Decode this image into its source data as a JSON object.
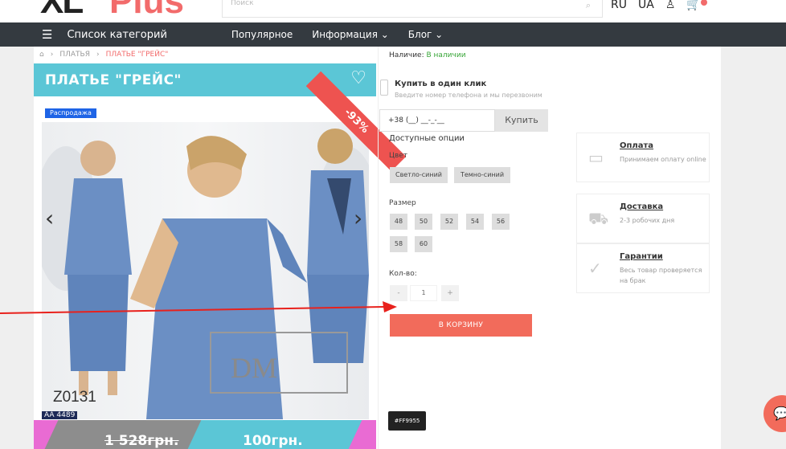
{
  "header": {
    "logo_xl": "XL",
    "logo_plus": "Plus",
    "search_placeholder": "Поиск",
    "lang": "RU",
    "lang_alt": "UA"
  },
  "nav": {
    "categories": "Список категорий",
    "items": [
      "Популярное",
      "Информация ⌄",
      "Блог ⌄"
    ]
  },
  "breadcrumb": {
    "level1": "ПЛАТЬЯ",
    "current": "ПЛАТЬЕ \"ГРЕЙС\""
  },
  "product": {
    "title": "ПЛАТЬЕ \"ГРЕЙС\"",
    "sale_badge": "Распродажа",
    "discount": "-93%",
    "code": "Z0131",
    "sku": "AA 4489",
    "price_old": "1 528грн.",
    "price_new": "100грн."
  },
  "stock": {
    "label": "Наличие:",
    "value": "В наличии"
  },
  "oneclick": {
    "title": "Купить в один клик",
    "hint": "Введите номер телефона и мы перезвоним",
    "phone_value": "+38 (__) __-_-__",
    "button": "Купить"
  },
  "options": {
    "title": "Доступные опции",
    "color_label": "Цвет",
    "colors": [
      "Светло-синий",
      "Темно-синий"
    ],
    "size_label": "Размер",
    "sizes": [
      "48",
      "50",
      "52",
      "54",
      "56",
      "58",
      "60"
    ],
    "qty_label": "Кол-во:",
    "qty_minus": "-",
    "qty_value": "1",
    "qty_plus": "+",
    "cart_button": "В КОРЗИНУ"
  },
  "info_cards": [
    {
      "title": "Оплата",
      "text": "Принимаем оплату online"
    },
    {
      "title": "Доставка",
      "text": "2-3 робочих дня"
    },
    {
      "title": "Гарантии",
      "text": "Весь товар проверяется на брак"
    }
  ],
  "color_tag": "#FF9955",
  "colors": {
    "accent": "#5bc6d6",
    "cart": "#f26b5b",
    "nav_bg": "#343a40",
    "price_strip": "#e96bd3",
    "annotation_arrow": "#e8211c"
  }
}
